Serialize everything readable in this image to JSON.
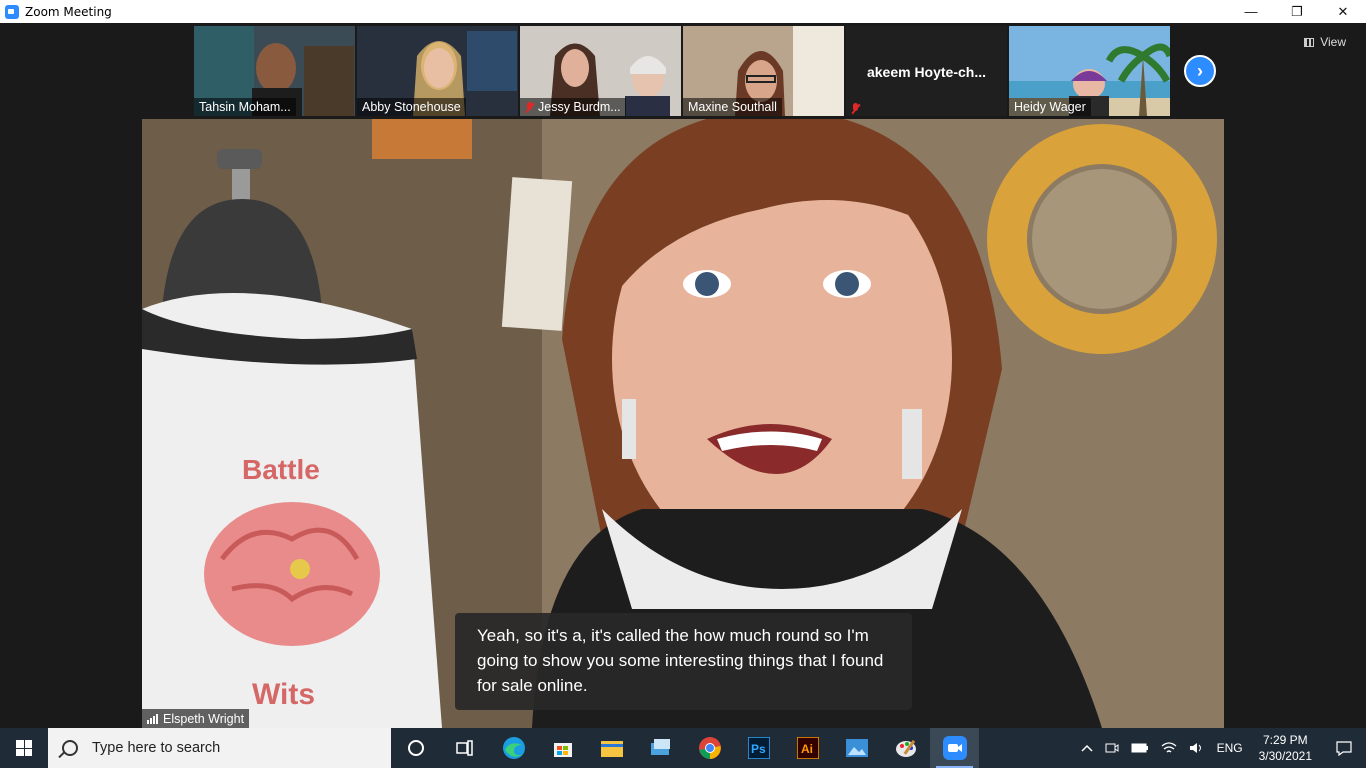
{
  "window": {
    "title": "Zoom Meeting",
    "minimize_glyph": "—",
    "restore_glyph": "❐",
    "close_glyph": "✕"
  },
  "meeting": {
    "view_label": "View",
    "participants": [
      {
        "name": "Tahsin Moham...",
        "muted": false,
        "video": true
      },
      {
        "name": "Abby Stonehouse",
        "muted": false,
        "video": true
      },
      {
        "name": "Jessy Burdm...",
        "muted": true,
        "video": true
      },
      {
        "name": "Maxine Southall",
        "muted": false,
        "video": true
      },
      {
        "name": "akeem  Hoyte-ch...",
        "muted": true,
        "video": false
      },
      {
        "name": "Heidy Wager",
        "muted": false,
        "video": true
      }
    ],
    "active_speaker": "Elspeth Wright",
    "shirt_text_top": "Battle",
    "shirt_text_bottom": "Wits",
    "caption": "Yeah, so it's a, it's called the how much round so I'm going to show you some interesting things that I found for sale online."
  },
  "taskbar": {
    "search_placeholder": "Type here to search",
    "apps": [
      "cortana-icon",
      "task-view-icon",
      "edge-icon",
      "store-icon",
      "file-explorer-icon",
      "windows-explorer-icon",
      "chrome-icon",
      "photoshop-icon",
      "illustrator-icon",
      "photos-icon",
      "paint-icon",
      "zoom-icon"
    ],
    "photoshop_label": "Ps",
    "illustrator_label": "Ai",
    "language": "ENG",
    "time": "7:29 PM",
    "date": "3/30/2021"
  },
  "colors": {
    "zoom_blue": "#2d8cff",
    "taskbar_bg": "#1f2b36",
    "muted_red": "#e02828"
  }
}
